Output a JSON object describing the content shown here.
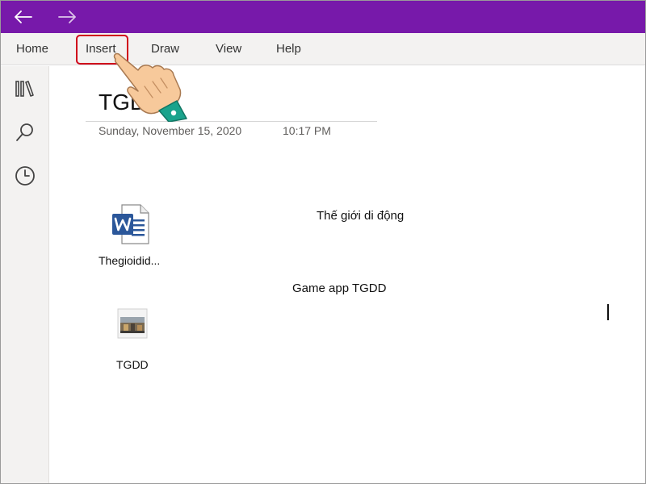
{
  "window": {
    "back_icon": "arrow-left-icon",
    "forward_icon": "arrow-right-icon",
    "titlebar_color": "#7719aa"
  },
  "ribbon": {
    "tabs": [
      {
        "label": "Home"
      },
      {
        "label": "Insert",
        "highlighted": true
      },
      {
        "label": "Draw"
      },
      {
        "label": "View"
      },
      {
        "label": "Help"
      }
    ],
    "highlight_color": "#d0021b"
  },
  "sidebar": {
    "icons": [
      "notebooks-icon",
      "search-icon",
      "recent-icon"
    ]
  },
  "page": {
    "title": "TGD",
    "date": "Sunday, November 15, 2020",
    "time": "10:17 PM",
    "notes": [
      "Thế giới di động",
      "Game app TGDD"
    ],
    "attachments": [
      {
        "type": "word-file-icon",
        "label": "Thegioidid..."
      },
      {
        "type": "image-file-icon",
        "label": "TGDD"
      }
    ]
  }
}
